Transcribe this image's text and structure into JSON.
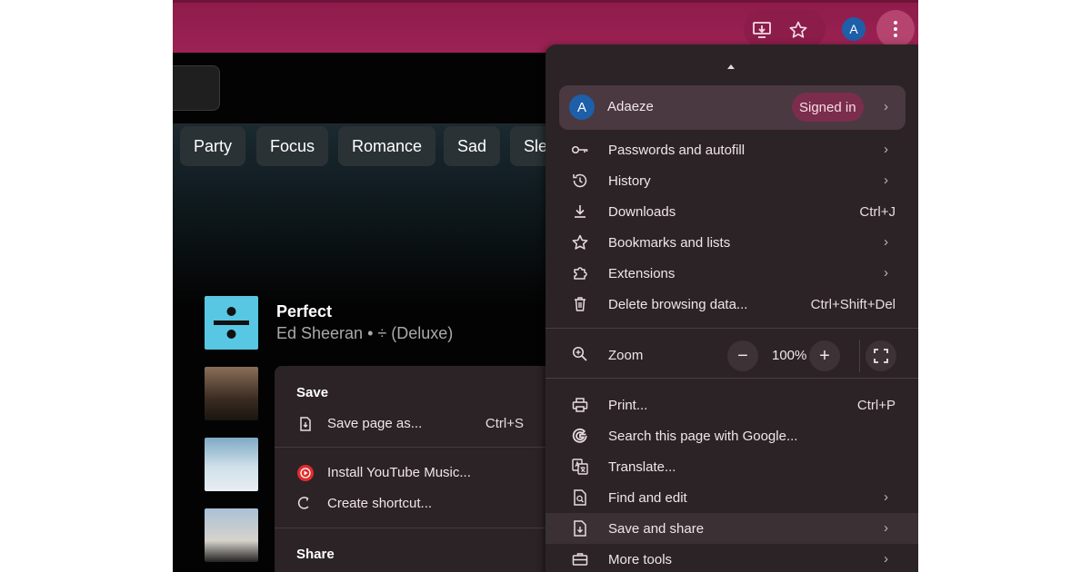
{
  "browser": {
    "toolbar": {
      "install_icon": "install-app-icon",
      "bookmark_icon": "star-icon",
      "profile_initial": "A",
      "menu_icon": "kebab-icon"
    }
  },
  "page": {
    "mood_chips": [
      "Party",
      "Focus",
      "Romance",
      "Sad",
      "Sle"
    ],
    "track": {
      "title": "Perfect",
      "subtitle": "Ed Sheeran • ÷ (Deluxe)"
    }
  },
  "submenu": {
    "save_heading": "Save",
    "save_page_label": "Save page as...",
    "save_page_shortcut": "Ctrl+S",
    "install_label": "Install YouTube Music...",
    "shortcut_label": "Create shortcut...",
    "share_heading": "Share"
  },
  "menu": {
    "profile": {
      "initial": "A",
      "name": "Adaeze",
      "badge": "Signed in"
    },
    "items": {
      "passwords": {
        "label": "Passwords and autofill"
      },
      "history": {
        "label": "History"
      },
      "downloads": {
        "label": "Downloads",
        "shortcut": "Ctrl+J"
      },
      "bookmarks": {
        "label": "Bookmarks and lists"
      },
      "extensions": {
        "label": "Extensions"
      },
      "delete_data": {
        "label": "Delete browsing data...",
        "shortcut": "Ctrl+Shift+Del"
      },
      "print": {
        "label": "Print...",
        "shortcut": "Ctrl+P"
      },
      "search_google": {
        "label": "Search this page with Google..."
      },
      "translate": {
        "label": "Translate..."
      },
      "find_edit": {
        "label": "Find and edit"
      },
      "save_share": {
        "label": "Save and share"
      },
      "more_tools": {
        "label": "More tools"
      }
    },
    "zoom": {
      "label": "Zoom",
      "value": "100%",
      "minus": "−",
      "plus": "+"
    }
  },
  "colors": {
    "titlebar": "#9c2254",
    "menu_bg": "#2b2326",
    "profile_bg": "#4a3940",
    "badge_bg": "#7a2d4c",
    "avatar": "#1d5fa8",
    "youtube_red": "#e22b2b"
  }
}
